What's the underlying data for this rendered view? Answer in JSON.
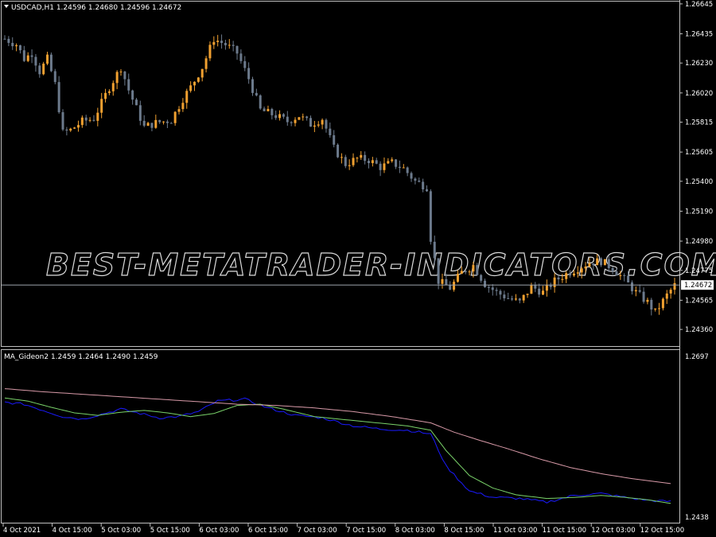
{
  "symbol_header": "USDCAD,H1  1.24596 1.24680 1.24596 1.24672",
  "indicator_header": "MA_Gideon2 1.2459 1.2464 1.2490 1.2459",
  "watermark": "BEST-METATRADER-INDICATORS.COM",
  "current_price_label": "1.24672",
  "colors": {
    "background": "#000000",
    "bull": "#f0a030",
    "bear": "#6c7a8c",
    "grid_frame": "#c0c0c0",
    "ma_blue": "#1a1aff",
    "ma_green": "#7ad36a",
    "ma_pink": "#d89aa8",
    "price_line": "#9aa0a8"
  },
  "icons": {
    "dropdown": "triangle-down-icon"
  },
  "chart_data": [
    {
      "type": "candlestick",
      "title": "USDCAD,H1",
      "ylim": [
        1.2426,
        1.2665
      ],
      "y_ticks": [
        "1.26645",
        "1.26435",
        "1.26230",
        "1.26020",
        "1.25815",
        "1.25605",
        "1.25400",
        "1.25190",
        "1.24980",
        "1.24775",
        "1.24565",
        "1.24360"
      ],
      "current_price": 1.24672,
      "anchors": [
        [
          0,
          1.264
        ],
        [
          3,
          1.2636
        ],
        [
          5,
          1.2626
        ],
        [
          7,
          1.263
        ],
        [
          9,
          1.2617
        ],
        [
          11,
          1.2626
        ],
        [
          13,
          1.2608
        ],
        [
          15,
          1.2574
        ],
        [
          17,
          1.2576
        ],
        [
          20,
          1.2582
        ],
        [
          23,
          1.2584
        ],
        [
          27,
          1.2606
        ],
        [
          30,
          1.262
        ],
        [
          32,
          1.2604
        ],
        [
          36,
          1.2578
        ],
        [
          39,
          1.2581
        ],
        [
          43,
          1.2583
        ],
        [
          46,
          1.2598
        ],
        [
          48,
          1.2606
        ],
        [
          51,
          1.262
        ],
        [
          54,
          1.264
        ],
        [
          57,
          1.2636
        ],
        [
          60,
          1.263
        ],
        [
          63,
          1.2612
        ],
        [
          66,
          1.259
        ],
        [
          70,
          1.2586
        ],
        [
          73,
          1.2582
        ],
        [
          76,
          1.2586
        ],
        [
          79,
          1.258
        ],
        [
          82,
          1.2584
        ],
        [
          85,
          1.2563
        ],
        [
          88,
          1.2552
        ],
        [
          91,
          1.2556
        ],
        [
          94,
          1.2555
        ],
        [
          97,
          1.255
        ],
        [
          100,
          1.2553
        ],
        [
          103,
          1.2549
        ],
        [
          106,
          1.254
        ],
        [
          109,
          1.2536
        ],
        [
          110,
          1.25
        ],
        [
          112,
          1.247
        ],
        [
          115,
          1.2465
        ],
        [
          118,
          1.2476
        ],
        [
          121,
          1.2481
        ],
        [
          124,
          1.2468
        ],
        [
          127,
          1.2462
        ],
        [
          130,
          1.2458
        ],
        [
          133,
          1.2455
        ],
        [
          136,
          1.2466
        ],
        [
          139,
          1.2462
        ],
        [
          142,
          1.247
        ],
        [
          145,
          1.2475
        ],
        [
          148,
          1.2479
        ],
        [
          151,
          1.2483
        ],
        [
          154,
          1.2484
        ],
        [
          157,
          1.2479
        ],
        [
          160,
          1.2471
        ],
        [
          163,
          1.2462
        ],
        [
          166,
          1.2455
        ],
        [
          168,
          1.2448
        ],
        [
          171,
          1.246
        ],
        [
          173,
          1.2467
        ]
      ],
      "candle_count": 174
    },
    {
      "type": "line",
      "title": "MA_Gideon2",
      "ylim": [
        1.2438,
        1.2697
      ],
      "y_ticks": [
        "1.2697",
        "1.2438"
      ],
      "x_tick_labels": [
        "4 Oct 2021",
        "4 Oct 15:00",
        "5 Oct 03:00",
        "5 Oct 15:00",
        "6 Oct 03:00",
        "6 Oct 15:00",
        "7 Oct 03:00",
        "7 Oct 15:00",
        "8 Oct 03:00",
        "8 Oct 15:00",
        "11 Oct 03:00",
        "11 Oct 15:00",
        "12 Oct 03:00",
        "12 Oct 15:00"
      ],
      "series": [
        {
          "values": [
            [
              0,
              1.2623
            ],
            [
              5,
              1.262
            ],
            [
              10,
              1.261
            ],
            [
              15,
              1.26
            ],
            [
              20,
              1.2596
            ],
            [
              25,
              1.2604
            ],
            [
              30,
              1.2612
            ],
            [
              35,
              1.2605
            ],
            [
              40,
              1.2598
            ],
            [
              45,
              1.26
            ],
            [
              50,
              1.2608
            ],
            [
              55,
              1.2625
            ],
            [
              62,
              1.2628
            ],
            [
              68,
              1.2614
            ],
            [
              75,
              1.2602
            ],
            [
              82,
              1.2598
            ],
            [
              90,
              1.2585
            ],
            [
              97,
              1.258
            ],
            [
              104,
              1.2578
            ],
            [
              110,
              1.2572
            ],
            [
              114,
              1.252
            ],
            [
              120,
              1.248
            ],
            [
              126,
              1.247
            ],
            [
              133,
              1.2468
            ],
            [
              140,
              1.2462
            ],
            [
              147,
              1.2473
            ],
            [
              154,
              1.2476
            ],
            [
              160,
              1.247
            ],
            [
              166,
              1.2465
            ],
            [
              172,
              1.2463
            ]
          ]
        },
        {
          "values": [
            [
              0,
              1.263
            ],
            [
              6,
              1.2625
            ],
            [
              12,
              1.2615
            ],
            [
              18,
              1.2606
            ],
            [
              24,
              1.2602
            ],
            [
              30,
              1.2607
            ],
            [
              36,
              1.261
            ],
            [
              42,
              1.2606
            ],
            [
              48,
              1.26
            ],
            [
              54,
              1.2605
            ],
            [
              60,
              1.2618
            ],
            [
              66,
              1.262
            ],
            [
              72,
              1.2612
            ],
            [
              80,
              1.26
            ],
            [
              88,
              1.2595
            ],
            [
              96,
              1.259
            ],
            [
              104,
              1.2585
            ],
            [
              110,
              1.2578
            ],
            [
              114,
              1.2545
            ],
            [
              120,
              1.2505
            ],
            [
              126,
              1.2485
            ],
            [
              132,
              1.2474
            ],
            [
              140,
              1.2468
            ],
            [
              148,
              1.247
            ],
            [
              154,
              1.2473
            ],
            [
              160,
              1.247
            ],
            [
              166,
              1.2466
            ],
            [
              172,
              1.246
            ]
          ]
        },
        {
          "values": [
            [
              0,
              1.2645
            ],
            [
              10,
              1.264
            ],
            [
              20,
              1.2636
            ],
            [
              30,
              1.2632
            ],
            [
              40,
              1.2628
            ],
            [
              50,
              1.2624
            ],
            [
              60,
              1.262
            ],
            [
              70,
              1.2618
            ],
            [
              80,
              1.2614
            ],
            [
              90,
              1.2608
            ],
            [
              100,
              1.26
            ],
            [
              110,
              1.259
            ],
            [
              116,
              1.2575
            ],
            [
              122,
              1.2563
            ],
            [
              130,
              1.2548
            ],
            [
              138,
              1.2532
            ],
            [
              146,
              1.2518
            ],
            [
              154,
              1.2508
            ],
            [
              162,
              1.25
            ],
            [
              172,
              1.2492
            ]
          ]
        }
      ]
    }
  ]
}
